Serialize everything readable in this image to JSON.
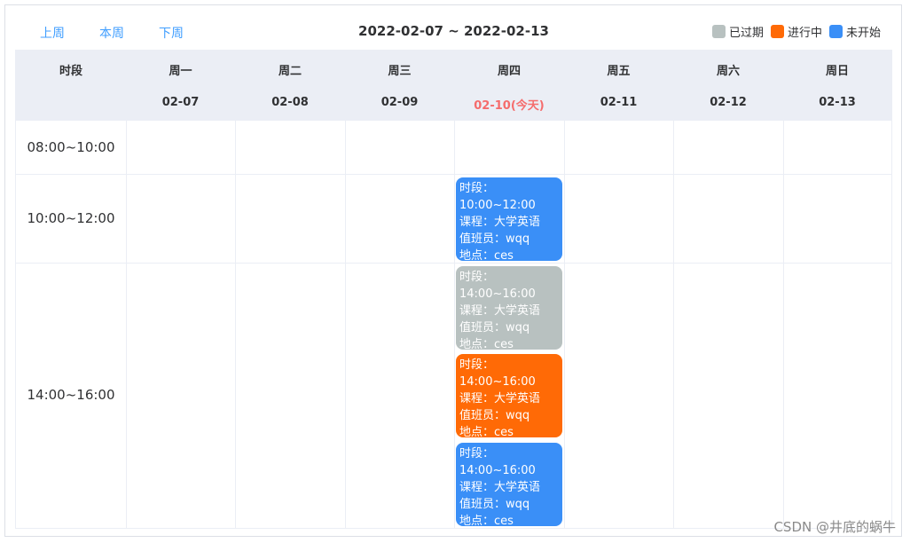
{
  "toolbar": {
    "prev_week": "上周",
    "this_week": "本周",
    "next_week": "下周",
    "date_range": "2022-02-07 ~ 2022-02-13"
  },
  "legend": [
    {
      "label": "已过期",
      "color": "#b8c1c0"
    },
    {
      "label": "进行中",
      "color": "#ff6a06"
    },
    {
      "label": "未开始",
      "color": "#3a8ff7"
    }
  ],
  "header": {
    "slot_label": "时段",
    "days": [
      {
        "weekday": "周一",
        "date": "02-07"
      },
      {
        "weekday": "周二",
        "date": "02-08"
      },
      {
        "weekday": "周三",
        "date": "02-09"
      },
      {
        "weekday": "周四",
        "date": "02-10(今天)",
        "today": true
      },
      {
        "weekday": "周五",
        "date": "02-11"
      },
      {
        "weekday": "周六",
        "date": "02-12"
      },
      {
        "weekday": "周日",
        "date": "02-13"
      }
    ]
  },
  "slots": [
    "08:00~10:00",
    "10:00~12:00",
    "14:00~16:00"
  ],
  "events": [
    {
      "status": "未开始",
      "color": "#3a8ff7",
      "lines": [
        "时段：",
        "10:00~12:00",
        "课程：大学英语",
        "值班员：wqq",
        "地点：ces"
      ]
    },
    {
      "status": "已过期",
      "color": "#b8c1c0",
      "lines": [
        "时段：",
        "14:00~16:00",
        "课程：大学英语",
        "值班员：wqq",
        "地点：ces"
      ]
    },
    {
      "status": "进行中",
      "color": "#ff6a06",
      "lines": [
        "时段：",
        "14:00~16:00",
        "课程：大学英语",
        "值班员：wqq",
        "地点：ces"
      ]
    },
    {
      "status": "未开始",
      "color": "#3a8ff7",
      "lines": [
        "时段：",
        "14:00~16:00",
        "课程：大学英语",
        "值班员：wqq",
        "地点：ces"
      ]
    }
  ],
  "watermark": "CSDN @井底的蜗牛"
}
